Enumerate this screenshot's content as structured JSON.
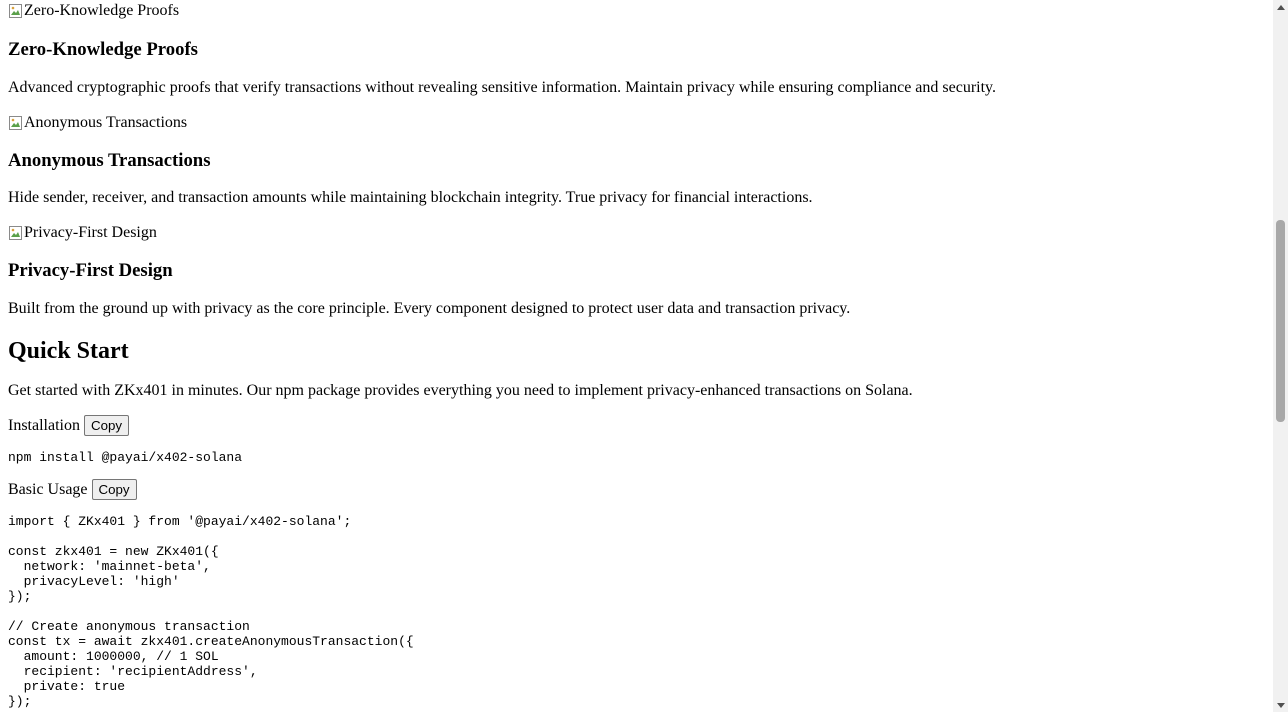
{
  "features": [
    {
      "image_alt": "Zero-Knowledge Proofs",
      "title": "Zero-Knowledge Proofs",
      "description": "Advanced cryptographic proofs that verify transactions without revealing sensitive information. Maintain privacy while ensuring compliance and security."
    },
    {
      "image_alt": "Anonymous Transactions",
      "title": "Anonymous Transactions",
      "description": "Hide sender, receiver, and transaction amounts while maintaining blockchain integrity. True privacy for financial interactions."
    },
    {
      "image_alt": "Privacy-First Design",
      "title": "Privacy-First Design",
      "description": "Built from the ground up with privacy as the core principle. Every component designed to protect user data and transaction privacy."
    }
  ],
  "quick_start": {
    "heading": "Quick Start",
    "intro": "Get started with ZKx401 in minutes. Our npm package provides everything you need to implement privacy-enhanced transactions on Solana.",
    "installation": {
      "label": "Installation",
      "copy_label": "Copy",
      "code": "npm install @payai/x402-solana"
    },
    "basic_usage": {
      "label": "Basic Usage",
      "copy_label": "Copy",
      "code": "import { ZKx401 } from '@payai/x402-solana';\n\nconst zkx401 = new ZKx401({\n  network: 'mainnet-beta',\n  privacyLevel: 'high'\n});\n\n// Create anonymous transaction\nconst tx = await zkx401.createAnonymousTransaction({\n  amount: 1000000, // 1 SOL\n  recipient: 'recipientAddress',\n  private: true\n});"
    }
  },
  "icons": {
    "broken_image": "broken-image-icon",
    "scroll_up": "scroll-up-arrow-icon",
    "scroll_down": "scroll-down-arrow-icon"
  }
}
